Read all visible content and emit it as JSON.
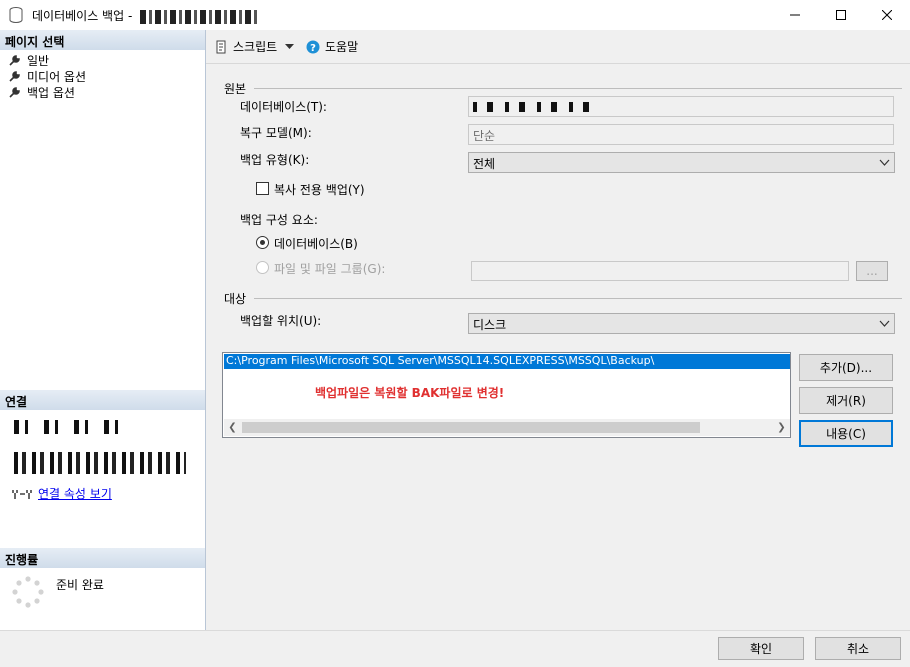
{
  "window": {
    "title": "데이터베이스 백업 -"
  },
  "sidebar": {
    "pages_header": "페이지 선택",
    "pages": [
      {
        "label": "일반"
      },
      {
        "label": "미디어 옵션"
      },
      {
        "label": "백업 옵션"
      }
    ],
    "connection_header": "연결",
    "connection_link": "연결 속성 보기",
    "progress_header": "진행률",
    "progress_status": "준비 완료"
  },
  "toolbar": {
    "script_label": "스크립트",
    "help_label": "도움말"
  },
  "form": {
    "source_group": "원본",
    "database_label": "데이터베이스(T):",
    "recovery_label": "복구 모델(M):",
    "recovery_value": "단순",
    "backup_type_label": "백업 유형(K):",
    "backup_type_value": "전체",
    "copy_only_label": "복사 전용 백업(Y)",
    "component_label": "백업 구성 요소:",
    "radio_database_label": "데이터베이스(B)",
    "radio_files_label": "파일 및 파일 그룹(G):",
    "files_browse_label": "...",
    "dest_group": "대상",
    "backup_to_label": "백업할 위치(U):",
    "backup_to_value": "디스크",
    "path_value": "C:\\Program Files\\Microsoft SQL Server\\MSSQL14.SQLEXPRESS\\MSSQL\\Backup\\",
    "annotation": "백업파일은 복원할 BAK파일로 변경!",
    "add_button": "추가(D)...",
    "remove_button": "제거(R)",
    "contents_button": "내용(C)"
  },
  "footer": {
    "ok_button": "확인",
    "cancel_button": "취소"
  },
  "colors": {
    "accent": "#0078d7",
    "annotation": "#e03030",
    "section_header": "#dbe5f0"
  }
}
